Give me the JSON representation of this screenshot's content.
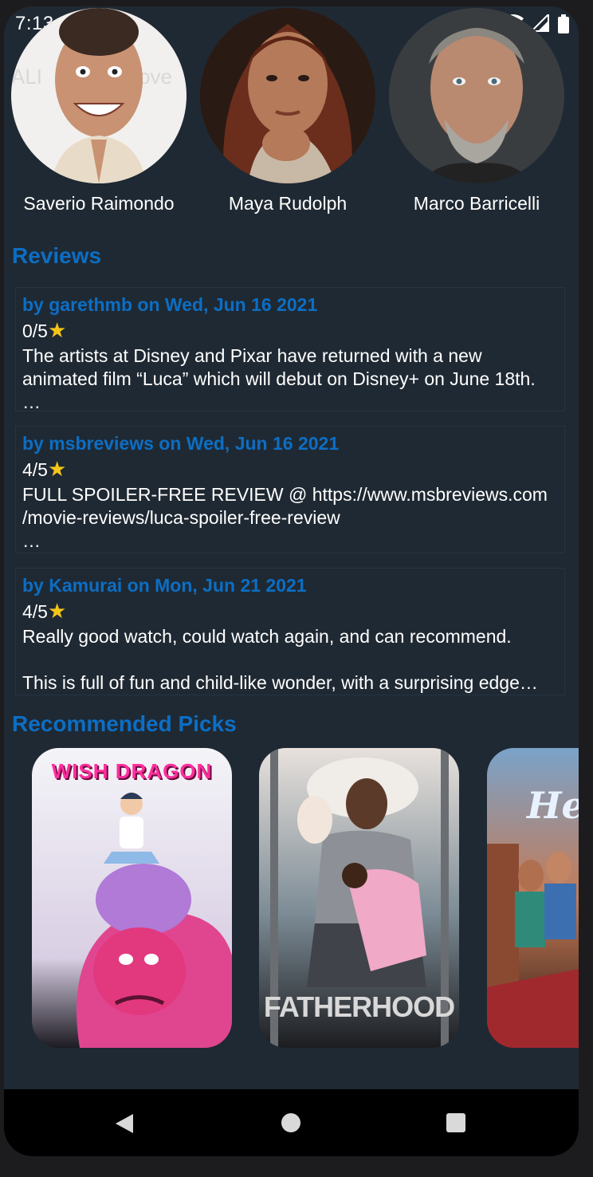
{
  "status_bar": {
    "time": "7:13"
  },
  "cast": [
    {
      "name": "Saverio Raimondo"
    },
    {
      "name": "Maya Rudolph"
    },
    {
      "name": "Marco Barricelli"
    }
  ],
  "reviews_section": {
    "title": "Reviews",
    "star": "★",
    "items": [
      {
        "author_line": "by garethmb on Wed, Jun 16 2021",
        "rating": "0/5",
        "text": "The artists at Disney and Pixar have returned with a new animated film “Luca” which will debut on Disney+ on June 18th. …"
      },
      {
        "author_line": "by msbreviews on Wed, Jun 16 2021",
        "rating": "4/5",
        "text": "FULL SPOILER-FREE REVIEW @ https://www.msbreviews.com\n/movie-reviews/luca-spoiler-free-review\n …"
      },
      {
        "author_line": "by Kamurai on Mon, Jun 21 2021",
        "rating": "4/5",
        "text": "Really good watch, could watch again, and can recommend.\n\nThis is full of fun and child-like wonder, with a surprising edge…"
      }
    ]
  },
  "recommended_section": {
    "title": "Recommended Picks",
    "posters": [
      {
        "title": "WISH DRAGON"
      },
      {
        "title": "FATHERHOOD"
      },
      {
        "title": "He"
      }
    ]
  },
  "colors": {
    "background": "#1f2933",
    "accent": "#0c6ec4",
    "star": "#f5c518",
    "text": "#ffffff"
  }
}
